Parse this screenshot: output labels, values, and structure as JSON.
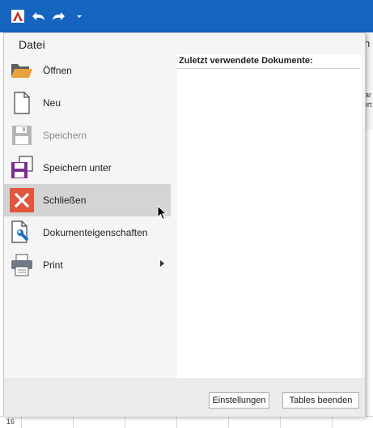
{
  "quickaccess": {
    "logo_icon": "app-logo-icon",
    "undo_icon": "undo-arrow-icon",
    "redo_icon": "redo-arrow-icon",
    "menu_icon": "chevron-down-icon"
  },
  "background": {
    "row_number": "16",
    "ribbon_fragment_char": "n",
    "ribbon_small_text_1": "ar",
    "ribbon_small_text_2": "ort"
  },
  "menu": {
    "title": "Datei",
    "items": [
      {
        "label": "Öffnen",
        "icon": "folder-open-icon",
        "state": "normal"
      },
      {
        "label": "Neu",
        "icon": "new-document-icon",
        "state": "normal"
      },
      {
        "label": "Speichern",
        "icon": "save-icon",
        "state": "disabled"
      },
      {
        "label": "Speichern unter",
        "icon": "save-as-icon",
        "state": "normal"
      },
      {
        "label": "Schließen",
        "icon": "close-x-icon",
        "state": "active"
      },
      {
        "label": "Dokumenteigenschaften",
        "icon": "document-properties-icon",
        "state": "normal"
      },
      {
        "label": "Print",
        "icon": "printer-icon",
        "state": "normal",
        "has_submenu": true
      }
    ],
    "recent_heading": "Zuletzt verwendete Dokumente:",
    "buttons": {
      "settings": "Einstellungen",
      "quit": "Tables beenden"
    }
  },
  "colors": {
    "titlebar": "#1565c0",
    "close_icon": "#e2553e",
    "save_as_accent": "#7b2d8e"
  }
}
